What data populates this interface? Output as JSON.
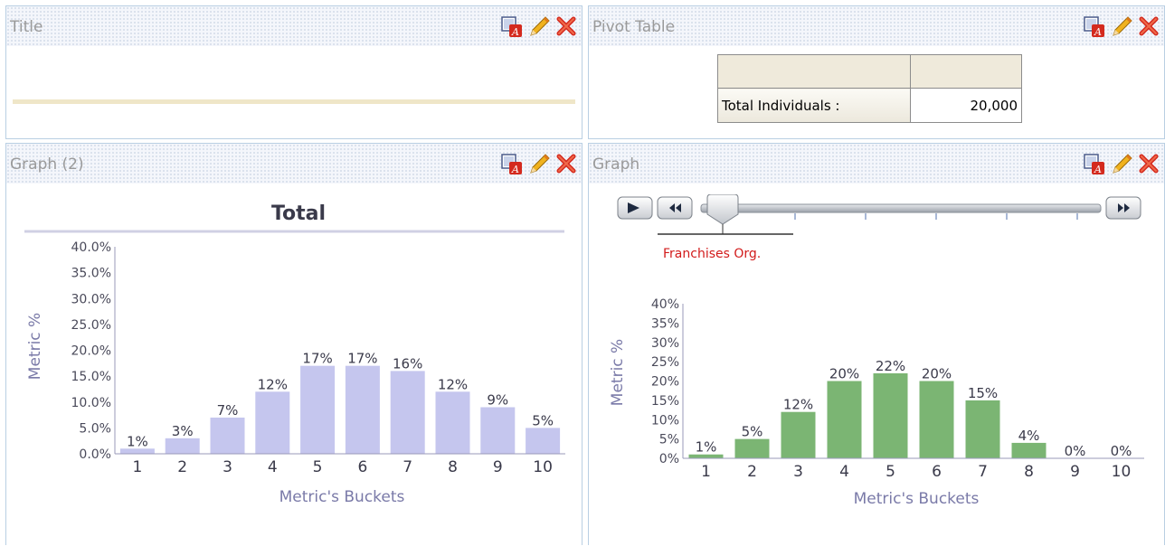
{
  "panels": {
    "title_panel": {
      "title": "Title"
    },
    "pivot_panel": {
      "title": "Pivot Table"
    },
    "graph2_panel": {
      "title": "Graph (2)"
    },
    "graph_panel": {
      "title": "Graph"
    }
  },
  "icons": [
    "format-icon",
    "edit-pencil-icon",
    "delete-x-icon"
  ],
  "pivot": {
    "row_label": "Total Individuals :",
    "row_value": "20,000"
  },
  "slider": {
    "selected": "Franchises Org.",
    "play_icon": "play-icon",
    "rewind_icon": "rewind-icon",
    "forward_icon": "fast-forward-icon"
  },
  "colors": {
    "bar_left": "#c5c6ee",
    "bar_right": "#7bb573",
    "axis_text": "#7a7aa8",
    "slider_label": "#d21b1b",
    "panel_border": "#b9cfe3"
  },
  "chart_data": [
    {
      "type": "bar",
      "title": "Total",
      "xlabel": "Metric's Buckets",
      "ylabel": "Metric %",
      "categories": [
        "1",
        "2",
        "3",
        "4",
        "5",
        "6",
        "7",
        "8",
        "9",
        "10"
      ],
      "values": [
        1,
        3,
        7,
        12,
        17,
        17,
        16,
        12,
        9,
        5
      ],
      "data_labels": [
        "1%",
        "3%",
        "7%",
        "12%",
        "17%",
        "17%",
        "16%",
        "12%",
        "9%",
        "5%"
      ],
      "yticks": [
        "0.0%",
        "5.0%",
        "10.0%",
        "15.0%",
        "20.0%",
        "25.0%",
        "30.0%",
        "35.0%",
        "40.0%"
      ],
      "ylim": [
        0,
        40
      ]
    },
    {
      "type": "bar",
      "title": "",
      "xlabel": "Metric's Buckets",
      "ylabel": "Metric %",
      "categories": [
        "1",
        "2",
        "3",
        "4",
        "5",
        "6",
        "7",
        "8",
        "9",
        "10"
      ],
      "values": [
        1,
        5,
        12,
        20,
        22,
        20,
        15,
        4,
        0,
        0
      ],
      "data_labels": [
        "1%",
        "5%",
        "12%",
        "20%",
        "22%",
        "20%",
        "15%",
        "4%",
        "0%",
        "0%"
      ],
      "yticks": [
        "0%",
        "5%",
        "10%",
        "15%",
        "20%",
        "25%",
        "30%",
        "35%",
        "40%"
      ],
      "ylim": [
        0,
        40
      ]
    }
  ]
}
